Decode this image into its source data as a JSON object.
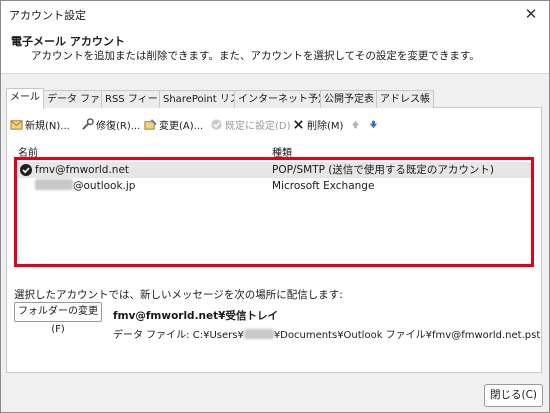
{
  "window": {
    "title": "アカウント設定"
  },
  "header": {
    "title": "電子メール アカウント",
    "subtitle": "アカウントを追加または削除できます。また、アカウントを選択してその設定を変更できます。"
  },
  "tabs": [
    {
      "label": "メール",
      "active": true
    },
    {
      "label": "データ ファイル"
    },
    {
      "label": "RSS フィード"
    },
    {
      "label": "SharePoint リスト"
    },
    {
      "label": "インターネット予定表"
    },
    {
      "label": "公開予定表"
    },
    {
      "label": "アドレス帳"
    }
  ],
  "toolbar": {
    "new": "新規(N)...",
    "repair": "修復(R)...",
    "change": "変更(A)...",
    "set_default": "既定に設定(D)",
    "delete": "削除(M)"
  },
  "columns": {
    "name": "名前",
    "type": "種類"
  },
  "accounts": [
    {
      "name": "fmv@fmworld.net",
      "type": "POP/SMTP (送信で使用する既定のアカウント)"
    },
    {
      "name": "@outlook.jp",
      "type": "Microsoft Exchange"
    }
  ],
  "delivery": {
    "label": "選択したアカウントでは、新しいメッセージを次の場所に配信します:",
    "change_folder_button": "フォルダーの変更(F)",
    "folder": "fmv@fmworld.net¥受信トレイ",
    "data_file_prefix": "データ ファイル:  C:¥Users¥",
    "data_file_suffix": "¥Documents¥Outlook ファイル¥fmv@fmworld.net.pst"
  },
  "close_button": "閉じる(C)"
}
